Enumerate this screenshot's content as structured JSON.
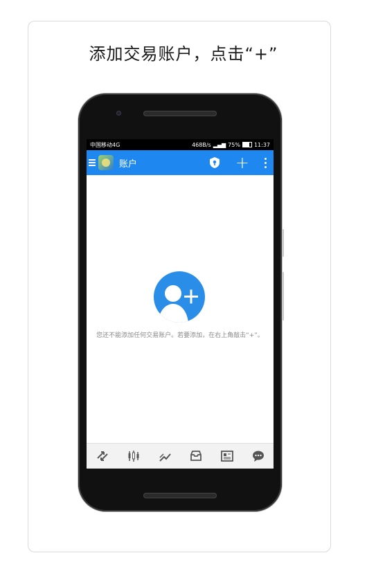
{
  "caption": "添加交易账户，点击“+”",
  "status_bar": {
    "carrier": "中国移动4G",
    "speed": "468B/s",
    "battery": "75%",
    "time": "11:37"
  },
  "app_bar": {
    "title": "账户",
    "icons": [
      "menu-icon",
      "app-logo",
      "shield-icon",
      "add-icon",
      "more-icon"
    ],
    "color": "#1e88f0"
  },
  "empty_state": {
    "icon": "add-person-icon",
    "message": "您还不能添加任何交易账户。若要添加，在右上角敲击“+”。"
  },
  "bottom_nav": {
    "items": [
      "quotes-icon",
      "chart-icon",
      "trade-icon",
      "history-icon",
      "news-icon",
      "chat-icon"
    ]
  }
}
